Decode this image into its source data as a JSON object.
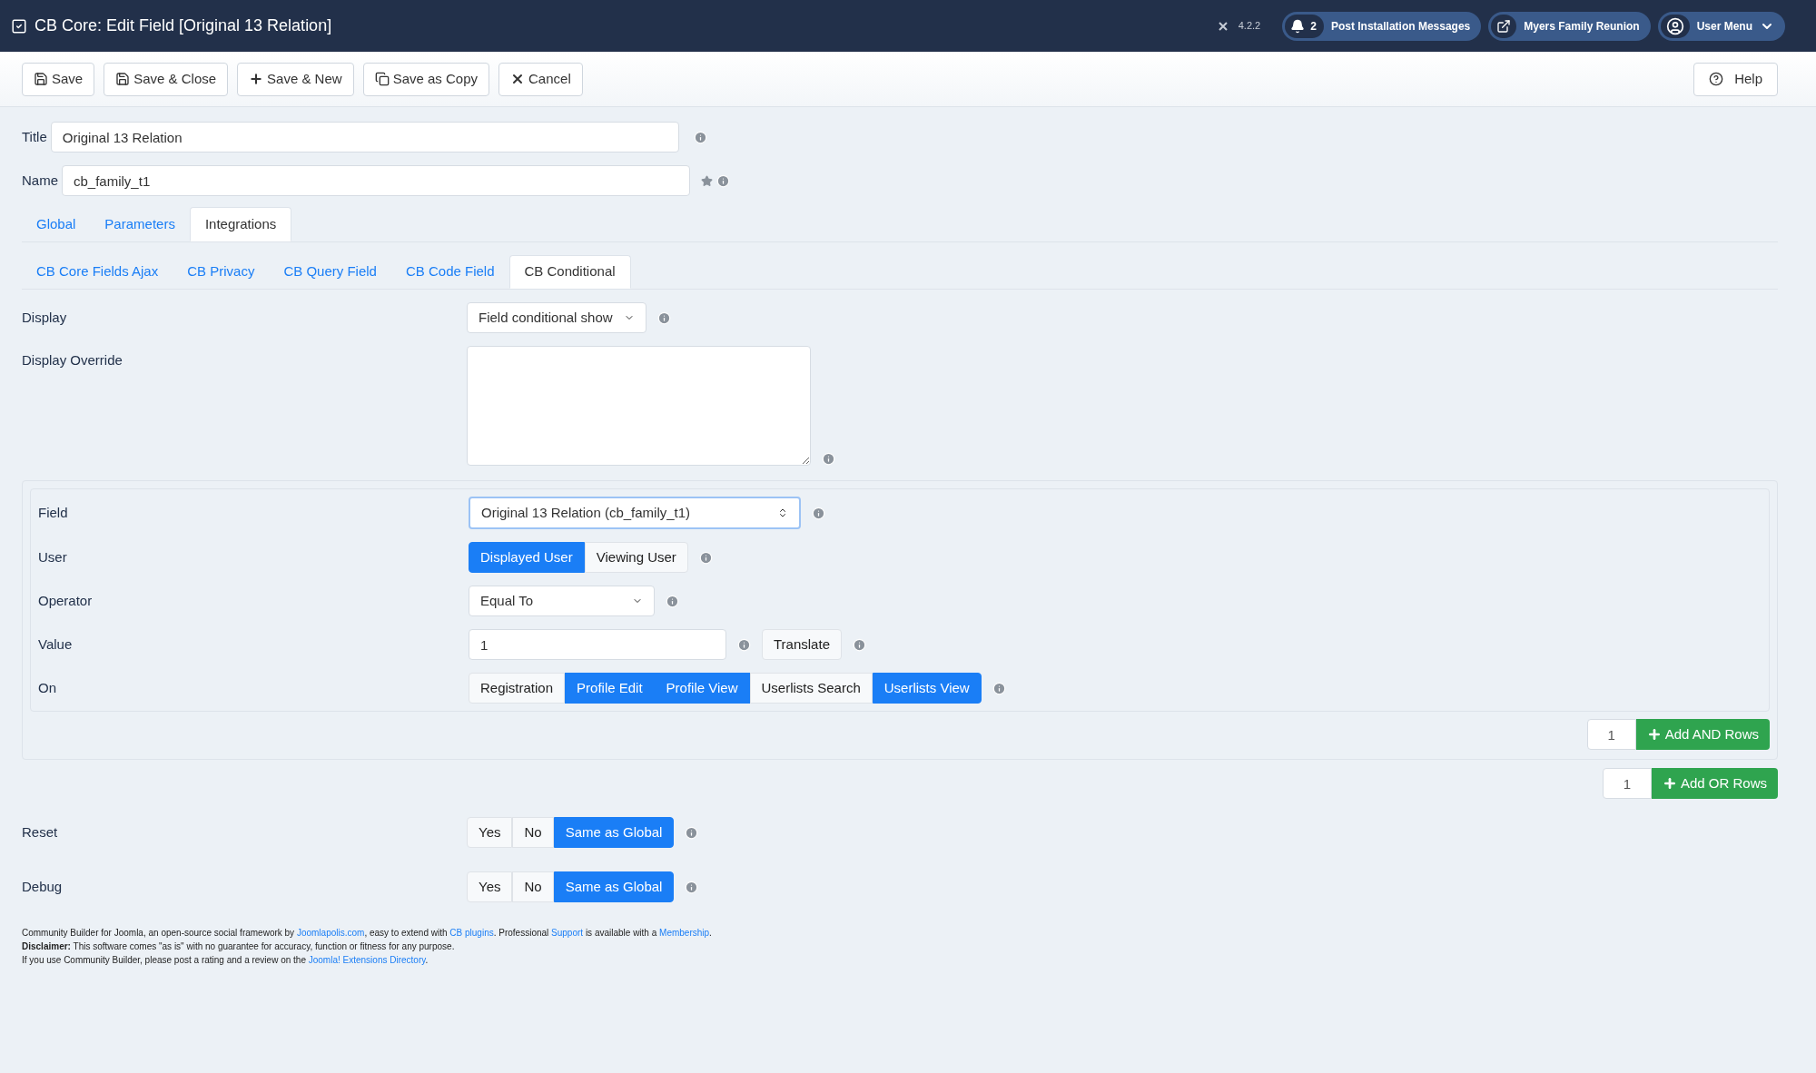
{
  "header": {
    "title": "CB Core: Edit Field [Original 13 Relation]",
    "version": "4.2.2",
    "pills": [
      {
        "kind": "bell",
        "badge": "2",
        "label": "Post Installation Messages"
      },
      {
        "kind": "external",
        "label": "Myers Family Reunion"
      },
      {
        "kind": "user",
        "label": "User Menu"
      }
    ]
  },
  "toolbar": {
    "buttons": [
      {
        "kind": "save",
        "label": "Save"
      },
      {
        "kind": "save",
        "label": "Save & Close"
      },
      {
        "kind": "plus",
        "label": "Save & New"
      },
      {
        "kind": "copy",
        "label": "Save as Copy"
      },
      {
        "kind": "cancel",
        "label": "Cancel"
      }
    ],
    "help": "Help"
  },
  "title_field": {
    "label": "Title",
    "value": "Original 13 Relation"
  },
  "name_field": {
    "label": "Name",
    "value": "cb_family_t1"
  },
  "tabs": [
    {
      "label": "Global",
      "selected": false
    },
    {
      "label": "Parameters",
      "selected": false
    },
    {
      "label": "Integrations",
      "selected": true
    }
  ],
  "subtabs": [
    {
      "label": "CB Core Fields Ajax",
      "selected": false
    },
    {
      "label": "CB Privacy",
      "selected": false
    },
    {
      "label": "CB Query Field",
      "selected": false
    },
    {
      "label": "CB Code Field",
      "selected": false
    },
    {
      "label": "CB Conditional",
      "selected": true
    }
  ],
  "display": {
    "label": "Display",
    "value": "Field conditional show"
  },
  "display_override": {
    "label": "Display Override"
  },
  "condition": {
    "field": {
      "label": "Field",
      "value": "Original 13 Relation (cb_family_t1)"
    },
    "user": {
      "label": "User",
      "options": [
        {
          "label": "Displayed User",
          "selected": true
        },
        {
          "label": "Viewing User",
          "selected": false
        }
      ]
    },
    "operator": {
      "label": "Operator",
      "value": "Equal To"
    },
    "value": {
      "label": "Value",
      "value": "1",
      "button": "Translate"
    },
    "on": {
      "label": "On",
      "options": [
        {
          "label": "Registration",
          "selected": false
        },
        {
          "label": "Profile Edit",
          "selected": true
        },
        {
          "label": "Profile View",
          "selected": true
        },
        {
          "label": "Userlists Search",
          "selected": false
        },
        {
          "label": "Userlists View",
          "selected": true
        }
      ]
    },
    "add_and": {
      "count": "1",
      "button": "Add AND Rows"
    }
  },
  "add_or": {
    "count": "1",
    "button": "Add OR Rows"
  },
  "toggles": [
    {
      "label": "Reset",
      "options": [
        {
          "label": "Yes",
          "selected": false
        },
        {
          "label": "No",
          "selected": false
        },
        {
          "label": "Same as Global",
          "selected": true
        }
      ]
    },
    {
      "label": "Debug",
      "options": [
        {
          "label": "Yes",
          "selected": false
        },
        {
          "label": "No",
          "selected": false
        },
        {
          "label": "Same as Global",
          "selected": true
        }
      ]
    }
  ],
  "footer": [
    [
      {
        "text": "Community Builder for Joomla, an open-source social framework by "
      },
      {
        "text": "Joomlapolis.com",
        "link": true
      },
      {
        "text": ", easy to extend with "
      },
      {
        "text": "CB plugins",
        "link": true
      },
      {
        "text": ". Professional "
      },
      {
        "text": "Support",
        "link": true
      },
      {
        "text": " is available with a "
      },
      {
        "text": "Membership",
        "link": true
      },
      {
        "text": "."
      }
    ],
    [
      {
        "text": "**Disclaimer:** This software comes \"as is\" with no guarantee for accuracy, function or fitness for any purpose."
      }
    ],
    [
      {
        "text": "If you use Community Builder, please post a rating and a review on the "
      },
      {
        "text": "Joomla! Extensions Directory",
        "link": true
      },
      {
        "text": "."
      }
    ]
  ]
}
